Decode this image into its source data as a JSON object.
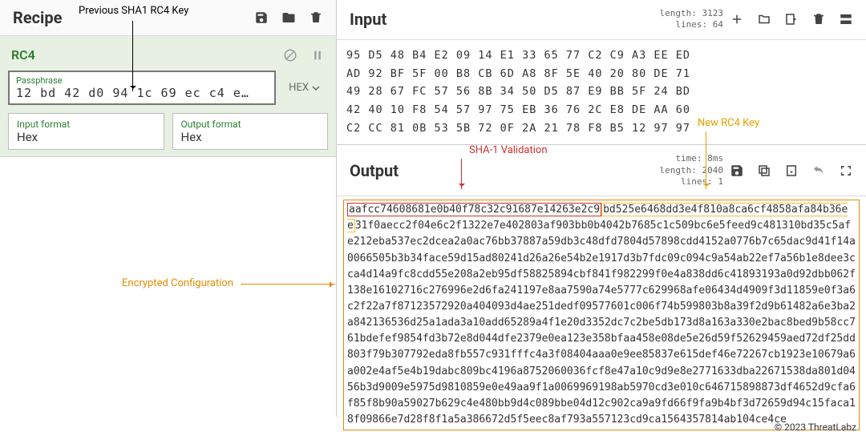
{
  "recipe": {
    "title": "Recipe",
    "operation": "RC4",
    "passphrase_label": "Passphrase",
    "passphrase_value": "12 bd 42 d0 94 1c 69 ec c4 e…",
    "hex_toggle": "HEX",
    "input_format_label": "Input format",
    "input_format_value": "Hex",
    "output_format_label": "Output format",
    "output_format_value": "Hex"
  },
  "input": {
    "title": "Input",
    "meta_length": "length:  3123",
    "meta_lines": "lines:    64",
    "rows": [
      "95 D5 48 B4 E2 09 14 E1 33 65 77 C2 C9 A3 EE ED",
      "AD 92 BF 5F 00 B8 CB 6D A8 8F 5E 40 20 80 DE 71",
      "49 28 67 FC 57 56 8B 34 50 D5 87 E9 BB 5F 24 BD",
      "42 40 10 F8 54 57 97 75 EB 36 76 2C E8 DE AA 60",
      "C2 CC 81 0B 53 5B 72 0F 2A 21 78 F8 B5 12 97 97"
    ]
  },
  "output": {
    "title": "Output",
    "meta_time": "time:   8ms",
    "meta_length": "length: 2040",
    "meta_lines": "lines:    1",
    "sha_part": "aafcc74608681e0b40f78c32c91687e14263e2c9",
    "key_part": "bd525e6468dd3e4f810a8ca6cf4858afa84b36ee",
    "rest": "31f0aecc2f04e6c2f1322e7e402803af903bb0b4042b7685c1c509bc6e5feed9c481310bd35c5afe212eba537ec2dcea2a0ac76bb37887a59db3c48dfd7804d57898cdd4152a0776b7c65dac9d41f14a0066505b3b34face59d15ad80241d26a26e54b2e1917d3b7fdc09c094c9a54ab22ef7a56b1e8dee3cca4d14a9fc8cdd55e208a2eb95df58825894cbf841f982299f0e4a838dd6c41893193a0d92dbb062f138e16102716c276996e2d6fa241197e8aa7590a74e5777c629968afe06434d4909f3d11859e0f3a6c2f22a7f87123572920a404093d4ae251dedf09577601c006f74b599803b8a39f2d9b61482a6e3ba2a842136536d25a1ada3a10add65289a4f1e20d3352dc7c2be5db173d8a163a330e2bac8bed9b58cc761bdefef9854fd3b72e8d044dfe2379e0ea123e358bfaa458e08de5e26d59f52629459aed72df25dd803f79b307792eda8fb557c931fffc4a3f08404aaa0e9ee85837e615def46e72267cb1923e10679a6a002e4af5e4b19dabc809bc4196a8752060036fcf8e47a10c9d9e8e2771633dba22671538da801d0456b3d9009e5975d9810859e0e49aa9f1a0069969198ab5970cd3e010c646715898873df4652d9cfa6f85f8b90a59027b629c4e480bb9d4c089bbe04d12c902ca9a9fd66f9fa9b4bf3d72659d94c15faca18f09866e7d28f8f1a5a386672d5f5eec8af793a557123cd9ca1564357814ab104ce4ce"
  },
  "annotations": {
    "prev_key": "Previous SHA1 RC4 Key",
    "sha": "SHA-1 Validation",
    "new_key": "New RC4 Key",
    "cfg": "Encrypted Configuration"
  },
  "footer": "© 2023 ThreatLabz"
}
